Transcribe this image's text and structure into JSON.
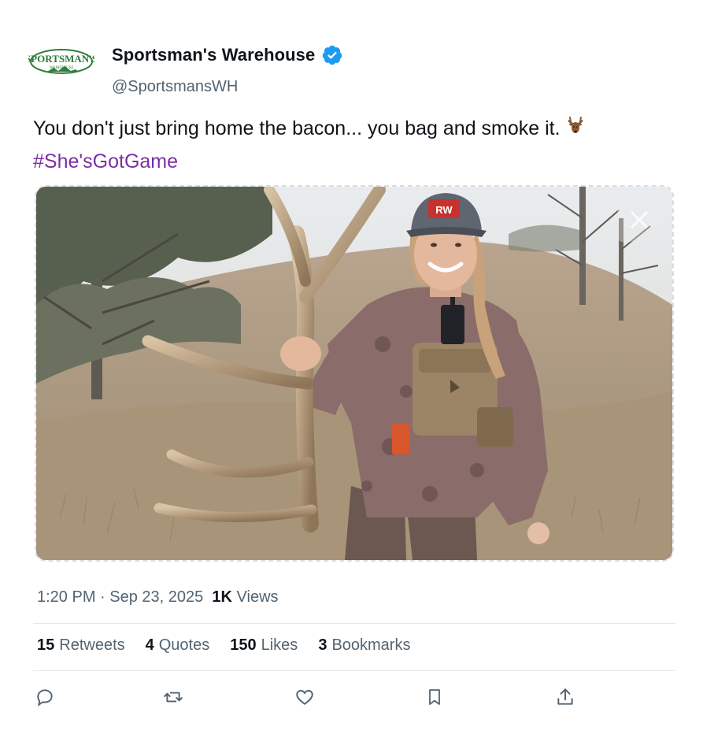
{
  "account": {
    "display_name": "Sportsman's Warehouse",
    "handle": "@SportsmansWH",
    "verified": true,
    "avatar_text_top": "SPORTSMAN'S",
    "avatar_text_bottom": "WAREHOUSE",
    "brand_color": "#2e7d3a"
  },
  "tweet": {
    "text": "You don't just bring home the bacon... you bag and smoke it.",
    "emoji_icon": "deer-icon",
    "hashtag": "#She'sGotGame",
    "hashtag_color": "#7b2fa3",
    "cap_logo": "RW"
  },
  "meta": {
    "time": "1:20 PM",
    "separator": "·",
    "date": "Sep 23, 2025",
    "views_count": "1K",
    "views_label": "Views"
  },
  "stats": {
    "retweets_count": "15",
    "retweets_label": "Retweets",
    "quotes_count": "4",
    "quotes_label": "Quotes",
    "likes_count": "150",
    "likes_label": "Likes",
    "bookmarks_count": "3",
    "bookmarks_label": "Bookmarks"
  },
  "actions": [
    {
      "name": "reply",
      "icon": "reply-icon"
    },
    {
      "name": "retweet",
      "icon": "retweet-icon"
    },
    {
      "name": "like",
      "icon": "heart-icon"
    },
    {
      "name": "bookmark",
      "icon": "bookmark-icon"
    },
    {
      "name": "share",
      "icon": "share-icon"
    }
  ],
  "colors": {
    "text": "#0f1419",
    "secondary": "#536471",
    "verified": "#1d9bf0",
    "divider": "#e4e8eb"
  }
}
